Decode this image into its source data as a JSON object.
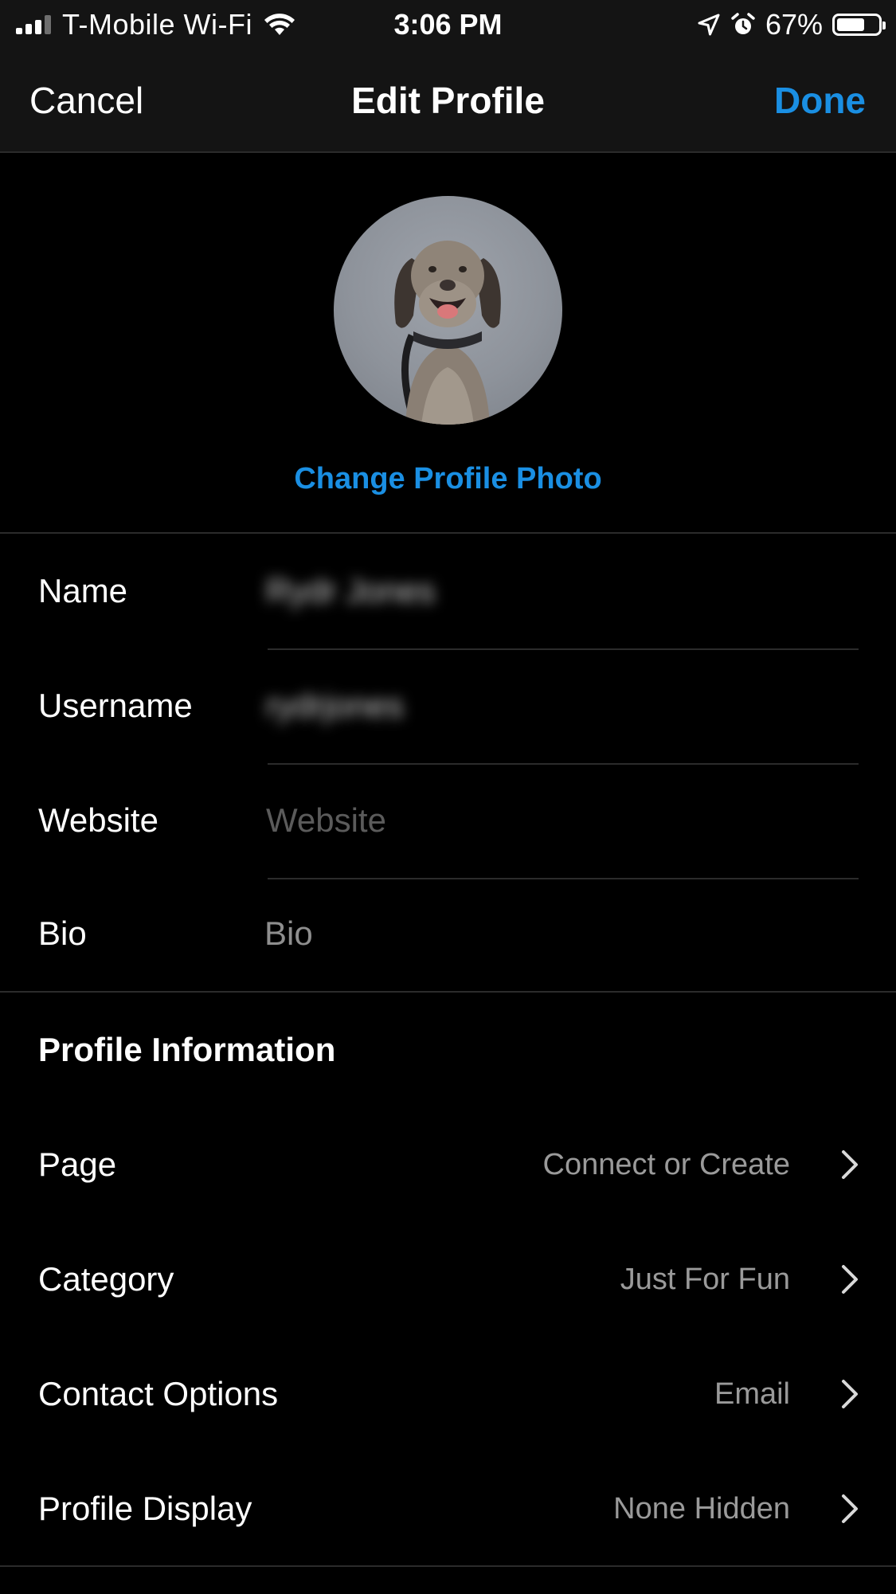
{
  "status_bar": {
    "carrier": "T-Mobile Wi-Fi",
    "time": "3:06 PM",
    "battery_percent": "67%",
    "battery_level": 0.67,
    "signal_bars_active": 3,
    "signal_bars_total": 4,
    "icons": [
      "signal-icon",
      "wifi-icon",
      "location-arrow-icon",
      "alarm-icon",
      "battery-icon"
    ]
  },
  "nav": {
    "cancel_label": "Cancel",
    "title": "Edit Profile",
    "done_label": "Done"
  },
  "profile_photo": {
    "change_label": "Change Profile Photo",
    "subject": "dog-photo"
  },
  "fields": {
    "name": {
      "label": "Name",
      "value": "Rydr Jones",
      "blurred": true
    },
    "username": {
      "label": "Username",
      "value": "rydrjones",
      "blurred": true
    },
    "website": {
      "label": "Website",
      "placeholder": "Website",
      "value": ""
    },
    "bio": {
      "label": "Bio",
      "placeholder": "Bio"
    }
  },
  "profile_information": {
    "title": "Profile Information",
    "rows": [
      {
        "label": "Page",
        "value": "Connect or Create"
      },
      {
        "label": "Category",
        "value": "Just For Fun"
      },
      {
        "label": "Contact Options",
        "value": "Email"
      },
      {
        "label": "Profile Display",
        "value": "None Hidden"
      }
    ]
  },
  "colors": {
    "background": "#000000",
    "header_background": "#141414",
    "accent_blue": "#1a8fe3",
    "secondary_text": "#9a9a9a",
    "placeholder_text": "#5b5b5b",
    "divider": "#2b2b2b"
  }
}
